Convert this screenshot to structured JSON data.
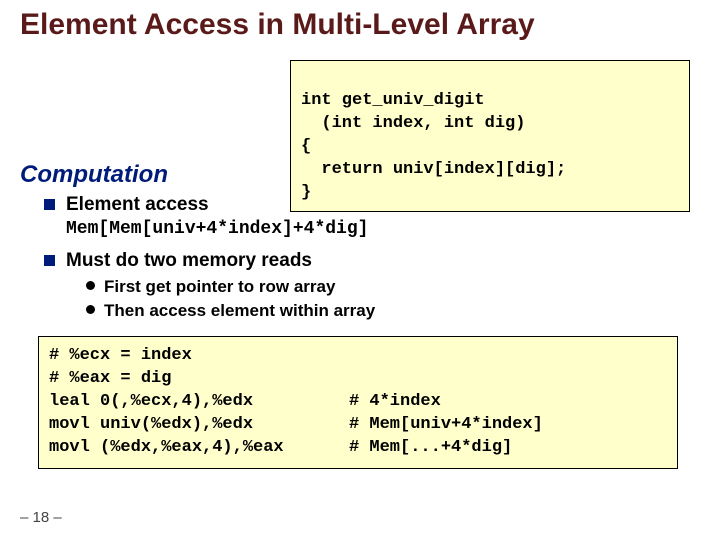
{
  "title": "Element Access in Multi-Level Array",
  "code": {
    "l1": "int get_univ_digit",
    "l2": "  (int index, int dig)",
    "l3": "{",
    "l4": "  return univ[index][dig];",
    "l5": "}"
  },
  "section": "Computation",
  "bullets": {
    "b1": "Element access",
    "memexpr": "Mem[Mem[univ+4*index]+4*dig]",
    "b2": "Must do two memory reads",
    "s1": "First get pointer to row array",
    "s2": "Then access element within array"
  },
  "asm": {
    "r1l": "# %ecx = index",
    "r2l": "# %eax = dig",
    "r3l": "leal 0(,%ecx,4),%edx",
    "r3r": "# 4*index",
    "r4l": "movl univ(%edx),%edx",
    "r4r": "# Mem[univ+4*index]",
    "r5l": "movl (%edx,%eax,4),%eax",
    "r5r": "# Mem[...+4*dig]"
  },
  "footer": "– 18 –"
}
